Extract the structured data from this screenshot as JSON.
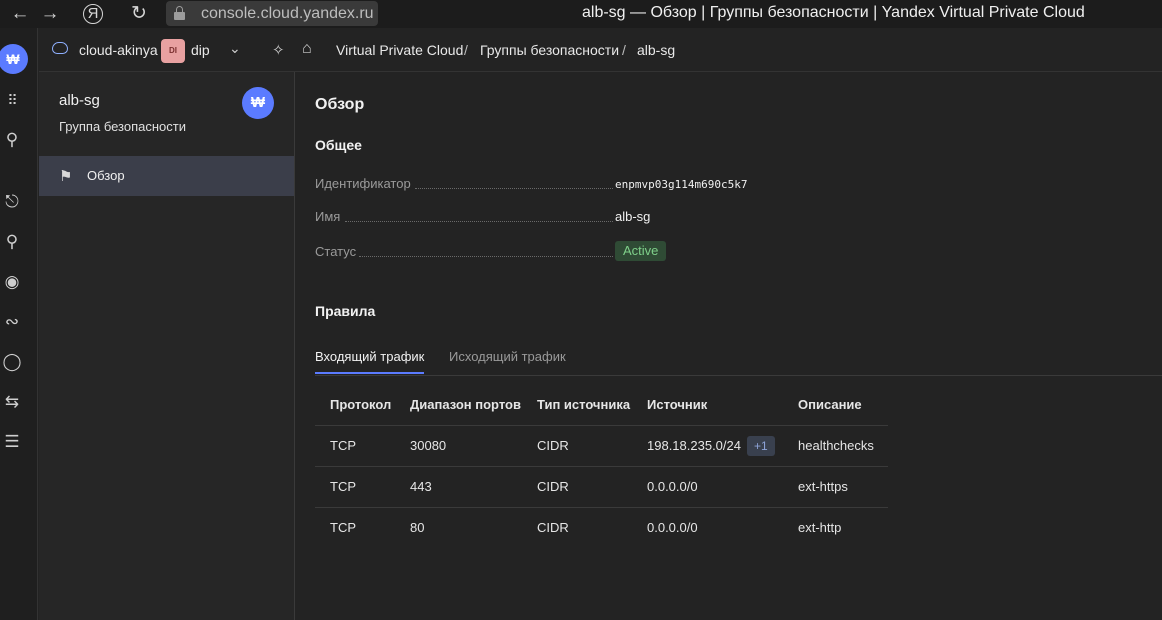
{
  "browser": {
    "url": "console.cloud.yandex.ru",
    "title": "alb-sg — Обзор | Группы безопасности | Yandex Virtual Private Cloud",
    "back_icon": "arrow-left-icon",
    "forward_icon": "arrow-right-icon",
    "yandex_icon": "yandex-browser-icon",
    "reload_icon": "reload-icon"
  },
  "header": {
    "cloud_name": "cloud-akinya",
    "folder_badge": "DI",
    "folder_name": "dip",
    "breadcrumbs": [
      "Virtual Private Cloud",
      "Группы безопасности",
      "alb-sg"
    ],
    "separator": "/"
  },
  "sidebar": {
    "title": "alb-sg",
    "subtitle": "Группа безопасности",
    "avatar_glyph": "₩",
    "items": [
      {
        "label": "Обзор",
        "icon": "flag-icon",
        "active": true
      }
    ]
  },
  "main": {
    "heading": "Обзор",
    "general_heading": "Общее",
    "fields": {
      "id_label": "Идентификатор",
      "id_value": "enpmvp03g114m690c5k7",
      "name_label": "Имя",
      "name_value": "alb-sg",
      "status_label": "Статус",
      "status_value": "Active"
    },
    "rules_heading": "Правила",
    "tabs": [
      "Входящий трафик",
      "Исходящий трафик"
    ],
    "table": {
      "headers": [
        "Протокол",
        "Диапазон портов",
        "Тип источника",
        "Источник",
        "Описание"
      ],
      "rows": [
        {
          "protocol": "TCP",
          "ports": "30080",
          "source_type": "CIDR",
          "source": "198.18.235.0/24",
          "extra": "+1",
          "description": "healthchecks"
        },
        {
          "protocol": "TCP",
          "ports": "443",
          "source_type": "CIDR",
          "source": "0.0.0.0/0",
          "description": "ext-https"
        },
        {
          "protocol": "TCP",
          "ports": "80",
          "source_type": "CIDR",
          "source": "0.0.0.0/0",
          "description": "ext-http"
        }
      ]
    }
  },
  "colors": {
    "accent": "#5b7bff",
    "status_green_bg": "#2f4b35",
    "status_green_text": "#7fd08a"
  }
}
